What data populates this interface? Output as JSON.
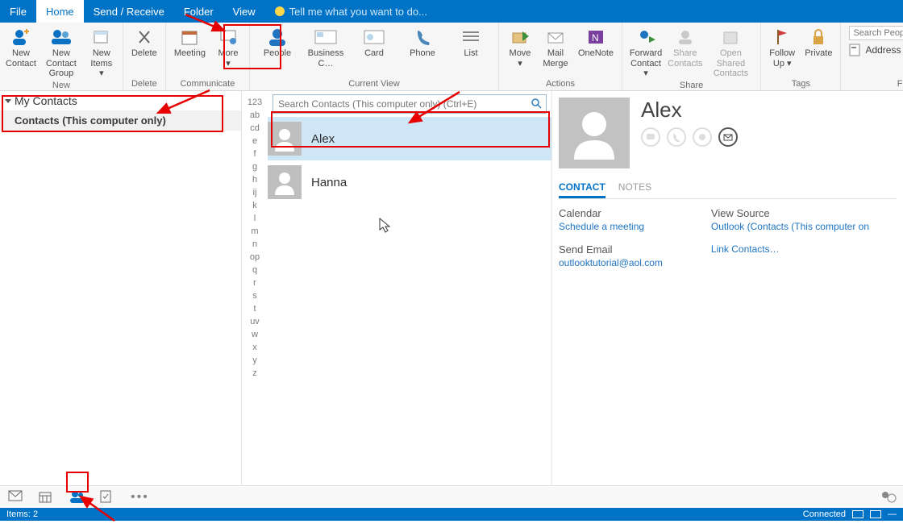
{
  "menu": {
    "file": "File",
    "home": "Home",
    "send_receive": "Send / Receive",
    "folder": "Folder",
    "view": "View",
    "tell_me": "Tell me what you want to do..."
  },
  "ribbon": {
    "new": {
      "new_contact": "New\nContact",
      "new_contact_group": "New Contact\nGroup",
      "new_items": "New\nItems ▾",
      "label": "New"
    },
    "delete": {
      "btn": "Delete",
      "label": "Delete"
    },
    "communicate": {
      "meeting": "Meeting",
      "more": "More\n▾",
      "label": "Communicate"
    },
    "view": {
      "people": "People",
      "business": "Business C…",
      "card": "Card",
      "phone": "Phone",
      "list": "List",
      "label": "Current View"
    },
    "actions": {
      "move": "Move\n▾",
      "mail_merge": "Mail\nMerge",
      "onenote": "OneNote",
      "label": "Actions"
    },
    "share": {
      "forward": "Forward\nContact ▾",
      "share": "Share\nContacts",
      "open": "Open Shared\nContacts",
      "label": "Share"
    },
    "tags": {
      "follow": "Follow\nUp ▾",
      "private": "Private",
      "label": "Tags"
    },
    "find": {
      "search_placeholder": "Search People",
      "address_book": "Address Book",
      "label": "Find"
    }
  },
  "sidebar": {
    "header": "My Contacts",
    "item": "Contacts (This computer only)"
  },
  "search_box_placeholder": "Search Contacts (This computer only) (Ctrl+E)",
  "alpha": [
    "123",
    "ab",
    "cd",
    "e",
    "f",
    "g",
    "h",
    "ij",
    "k",
    "l",
    "m",
    "n",
    "op",
    "q",
    "r",
    "s",
    "t",
    "uv",
    "w",
    "x",
    "y",
    "z"
  ],
  "contacts": [
    {
      "name": "Alex",
      "selected": true
    },
    {
      "name": "Hanna",
      "selected": false
    }
  ],
  "reading": {
    "name": "Alex",
    "tabs": {
      "contact": "CONTACT",
      "notes": "NOTES"
    },
    "calendar_label": "Calendar",
    "schedule_link": "Schedule a meeting",
    "send_email_label": "Send Email",
    "email": "outlooktutorial@aol.com",
    "view_source_label": "View Source",
    "source_link": "Outlook (Contacts (This computer on",
    "link_contacts": "Link Contacts…"
  },
  "status": {
    "items": "Items: 2",
    "connected": "Connected"
  }
}
